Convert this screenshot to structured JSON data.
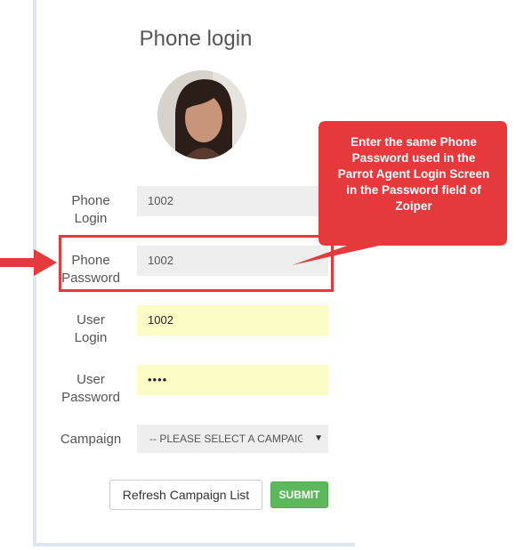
{
  "form": {
    "title": "Phone login",
    "fields": {
      "phone_login": {
        "label_line1": "Phone",
        "label_line2": "Login",
        "value": "1002"
      },
      "phone_password": {
        "label_line1": "Phone",
        "label_line2": "Password",
        "value": "1002"
      },
      "user_login": {
        "label_line1": "User",
        "label_line2": "Login",
        "value": "1002"
      },
      "user_password": {
        "label_line1": "User",
        "label_line2": "Password",
        "value": "••••"
      },
      "campaign": {
        "label": "Campaign",
        "selected": "-- PLEASE SELECT A CAMPAIGN --"
      }
    },
    "buttons": {
      "refresh": "Refresh Campaign List",
      "submit": "SUBMIT"
    }
  },
  "annotation": {
    "callout_text": "Enter the same Phone Password used in the Parrot Agent Login Screen in the Password field of Zoiper",
    "color": "#e5393b"
  },
  "colors": {
    "input_bg": "#eeeeee",
    "autofill_bg": "#fbfcc5",
    "submit_bg": "#5cb85c",
    "panel_border": "#dfe7ee"
  },
  "icons": {
    "dropdown_caret": "triangle-down",
    "pointer": "arrow-right"
  }
}
